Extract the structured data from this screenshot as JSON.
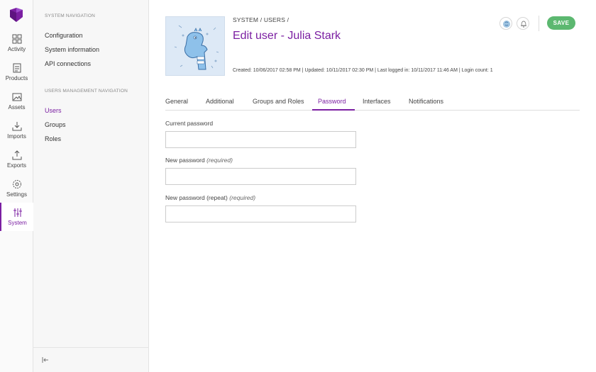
{
  "rail": {
    "items": [
      {
        "label": "Activity",
        "icon": "activity-icon"
      },
      {
        "label": "Products",
        "icon": "products-icon"
      },
      {
        "label": "Assets",
        "icon": "assets-icon"
      },
      {
        "label": "Imports",
        "icon": "imports-icon"
      },
      {
        "label": "Exports",
        "icon": "exports-icon"
      },
      {
        "label": "Settings",
        "icon": "settings-icon"
      },
      {
        "label": "System",
        "icon": "system-icon",
        "active": true
      }
    ]
  },
  "subnav": {
    "system_heading": "SYSTEM NAVIGATION",
    "system_links": [
      "Configuration",
      "System information",
      "API connections"
    ],
    "users_heading": "USERS MANAGEMENT NAVIGATION",
    "users_links": [
      "Users",
      "Groups",
      "Roles"
    ],
    "active_link": "Users"
  },
  "header": {
    "breadcrumb": "SYSTEM / USERS /",
    "title": "Edit user - Julia Stark",
    "meta": "Created: 10/06/2017 02:58 PM | Updated: 10/11/2017 02:30 PM | Last logged in: 10/11/2017 11:46 AM | Login count: 1",
    "save_label": "SAVE"
  },
  "tabs": [
    "General",
    "Additional",
    "Groups and Roles",
    "Password",
    "Interfaces",
    "Notifications"
  ],
  "active_tab": "Password",
  "form": {
    "current_password_label": "Current password",
    "new_password_label": "New password",
    "new_password_hint": "(required)",
    "repeat_password_label": "New password (repeat)",
    "repeat_password_hint": "(required)",
    "current_password_value": "",
    "new_password_value": "",
    "repeat_password_value": ""
  },
  "colors": {
    "accent": "#7b1fa2",
    "save": "#5cb870"
  }
}
